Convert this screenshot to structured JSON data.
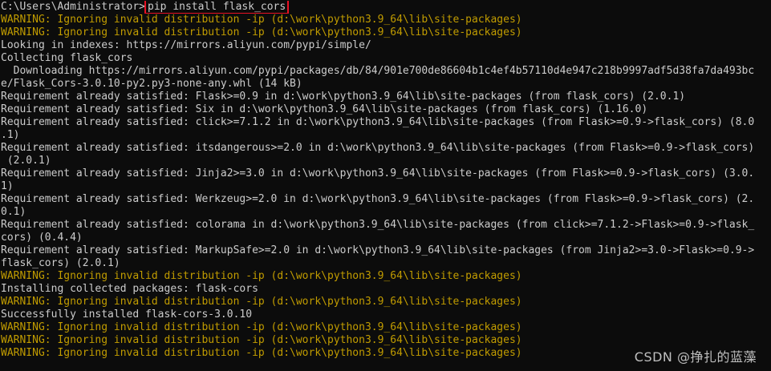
{
  "terminal": {
    "prompt": "C:\\Users\\Administrator>",
    "command": "pip install flask_cors",
    "lines": [
      {
        "text": "WARNING: Ignoring invalid distribution -ip (d:\\work\\python3.9_64\\lib\\site-packages)",
        "type": "warn"
      },
      {
        "text": "WARNING: Ignoring invalid distribution -ip (d:\\work\\python3.9_64\\lib\\site-packages)",
        "type": "warn"
      },
      {
        "text": "Looking in indexes: https://mirrors.aliyun.com/pypi/simple/",
        "type": "normal"
      },
      {
        "text": "Collecting flask_cors",
        "type": "normal"
      },
      {
        "text": "  Downloading https://mirrors.aliyun.com/pypi/packages/db/84/901e700de86604b1c4ef4b57110d4e947c218b9997adf5d38fa7da493bc",
        "type": "normal"
      },
      {
        "text": "e/Flask_Cors-3.0.10-py2.py3-none-any.whl (14 kB)",
        "type": "normal"
      },
      {
        "text": "Requirement already satisfied: Flask>=0.9 in d:\\work\\python3.9_64\\lib\\site-packages (from flask_cors) (2.0.1)",
        "type": "normal"
      },
      {
        "text": "Requirement already satisfied: Six in d:\\work\\python3.9_64\\lib\\site-packages (from flask_cors) (1.16.0)",
        "type": "normal"
      },
      {
        "text": "Requirement already satisfied: click>=7.1.2 in d:\\work\\python3.9_64\\lib\\site-packages (from Flask>=0.9->flask_cors) (8.0",
        "type": "normal"
      },
      {
        "text": ".1)",
        "type": "normal"
      },
      {
        "text": "Requirement already satisfied: itsdangerous>=2.0 in d:\\work\\python3.9_64\\lib\\site-packages (from Flask>=0.9->flask_cors)",
        "type": "normal"
      },
      {
        "text": " (2.0.1)",
        "type": "normal"
      },
      {
        "text": "Requirement already satisfied: Jinja2>=3.0 in d:\\work\\python3.9_64\\lib\\site-packages (from Flask>=0.9->flask_cors) (3.0.",
        "type": "normal"
      },
      {
        "text": "1)",
        "type": "normal"
      },
      {
        "text": "Requirement already satisfied: Werkzeug>=2.0 in d:\\work\\python3.9_64\\lib\\site-packages (from Flask>=0.9->flask_cors) (2.",
        "type": "normal"
      },
      {
        "text": "0.1)",
        "type": "normal"
      },
      {
        "text": "Requirement already satisfied: colorama in d:\\work\\python3.9_64\\lib\\site-packages (from click>=7.1.2->Flask>=0.9->flask_",
        "type": "normal"
      },
      {
        "text": "cors) (0.4.4)",
        "type": "normal"
      },
      {
        "text": "Requirement already satisfied: MarkupSafe>=2.0 in d:\\work\\python3.9_64\\lib\\site-packages (from Jinja2>=3.0->Flask>=0.9->",
        "type": "normal"
      },
      {
        "text": "flask_cors) (2.0.1)",
        "type": "normal"
      },
      {
        "text": "WARNING: Ignoring invalid distribution -ip (d:\\work\\python3.9_64\\lib\\site-packages)",
        "type": "warn"
      },
      {
        "text": "Installing collected packages: flask-cors",
        "type": "normal"
      },
      {
        "text": "WARNING: Ignoring invalid distribution -ip (d:\\work\\python3.9_64\\lib\\site-packages)",
        "type": "warn"
      },
      {
        "text": "Successfully installed flask-cors-3.0.10",
        "type": "normal"
      },
      {
        "text": "WARNING: Ignoring invalid distribution -ip (d:\\work\\python3.9_64\\lib\\site-packages)",
        "type": "warn"
      },
      {
        "text": "WARNING: Ignoring invalid distribution -ip (d:\\work\\python3.9_64\\lib\\site-packages)",
        "type": "warn"
      },
      {
        "text": "WARNING: Ignoring invalid distribution -ip (d:\\work\\python3.9_64\\lib\\site-packages)",
        "type": "warn"
      }
    ]
  },
  "watermark": "CSDN @挣扎的蓝藻",
  "colors": {
    "background": "#0c0c0c",
    "text": "#cccccc",
    "warning": "#c19c00",
    "highlight_border": "#e81123"
  }
}
